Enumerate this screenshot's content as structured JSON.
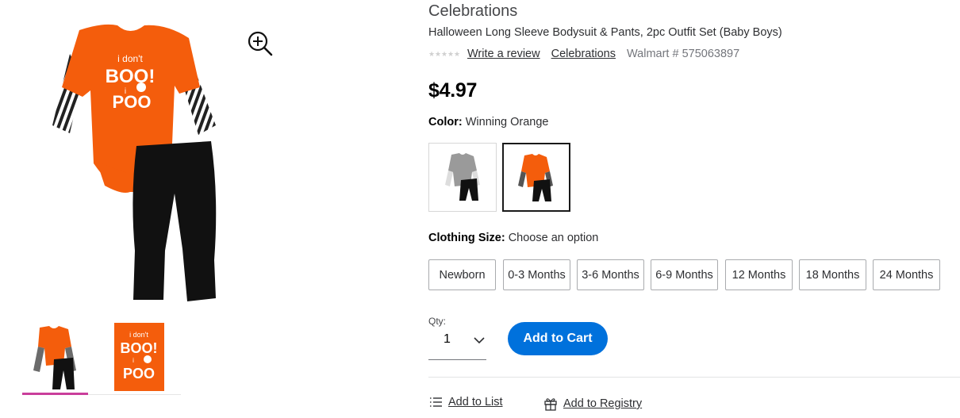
{
  "product": {
    "brand": "Celebrations",
    "name": "Halloween Long Sleeve Bodysuit & Pants, 2pc Outfit Set (Baby Boys)",
    "write_review": "Write a review",
    "brand_link": "Celebrations",
    "walmart_number": "Walmart # 575063897",
    "price": "$4.97",
    "rating_stars": 0
  },
  "images": {
    "main_alt": "i don't BOO! i POO",
    "thumb_text": "i don't BOO! i POO"
  },
  "color": {
    "label": "Color:",
    "value": "Winning Orange"
  },
  "size": {
    "label": "Clothing Size:",
    "value": "Choose an option",
    "options": [
      "Newborn",
      "0-3 Months",
      "3-6 Months",
      "6-9 Months",
      "12 Months",
      "18 Months",
      "24 Months"
    ]
  },
  "qty": {
    "label": "Qty:",
    "value": "1"
  },
  "actions": {
    "add_to_cart": "Add to Cart",
    "add_to_list": "Add to List",
    "add_to_registry": "Add to Registry"
  },
  "colors": {
    "accent_blue": "#0071dc",
    "thumb_active": "#c93e9b",
    "onesie_orange": "#f45d0c"
  },
  "icons": [
    "zoom-in-icon",
    "chevron-down-icon",
    "list-icon",
    "gift-icon"
  ]
}
